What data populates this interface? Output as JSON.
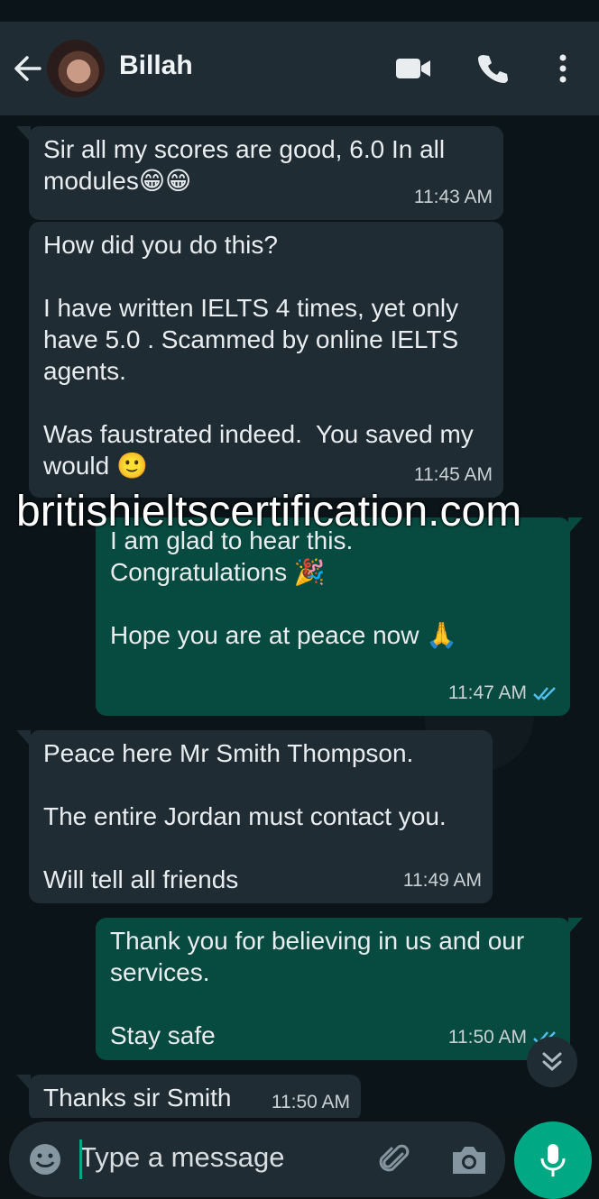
{
  "header": {
    "contact_name": "Billah",
    "icons": [
      "back-arrow-icon",
      "video-call-icon",
      "voice-call-icon",
      "more-options-icon"
    ]
  },
  "messages": [
    {
      "direction": "in",
      "text": "Sir all my scores are good, 6.0 In all modules😁😁",
      "time": "11:43 AM"
    },
    {
      "direction": "in",
      "text": "How did you do this?\n\nI have written IELTS 4 times, yet only have 5.0 . Scammed by online IELTS agents.\n\nWas faustrated indeed.  You saved my would 🙂",
      "time": "11:45 AM"
    },
    {
      "direction": "out",
      "text": "I am glad to hear this.\nCongratulations 🎉\n\nHope you are at peace now 🙏",
      "time": "11:47 AM",
      "status": "read"
    },
    {
      "direction": "in",
      "text": "Peace here Mr Smith Thompson.\n\nThe entire Jordan must contact you.\n\nWill tell all friends",
      "time": "11:49 AM"
    },
    {
      "direction": "out",
      "text": "Thank you for believing in us and our services.\n\nStay safe",
      "time": "11:50 AM",
      "status": "read"
    },
    {
      "direction": "in",
      "text": "Thanks sir Smith",
      "time": "11:50 AM"
    }
  ],
  "watermark": "britishieltscertification.com",
  "composer": {
    "placeholder": "Type a message"
  },
  "colors": {
    "header_bg": "#1f2c34",
    "incoming_bubble": "#1f2c33",
    "outgoing_bubble": "#074a3f",
    "accent": "#00a884",
    "read_ticks": "#53bdeb"
  }
}
